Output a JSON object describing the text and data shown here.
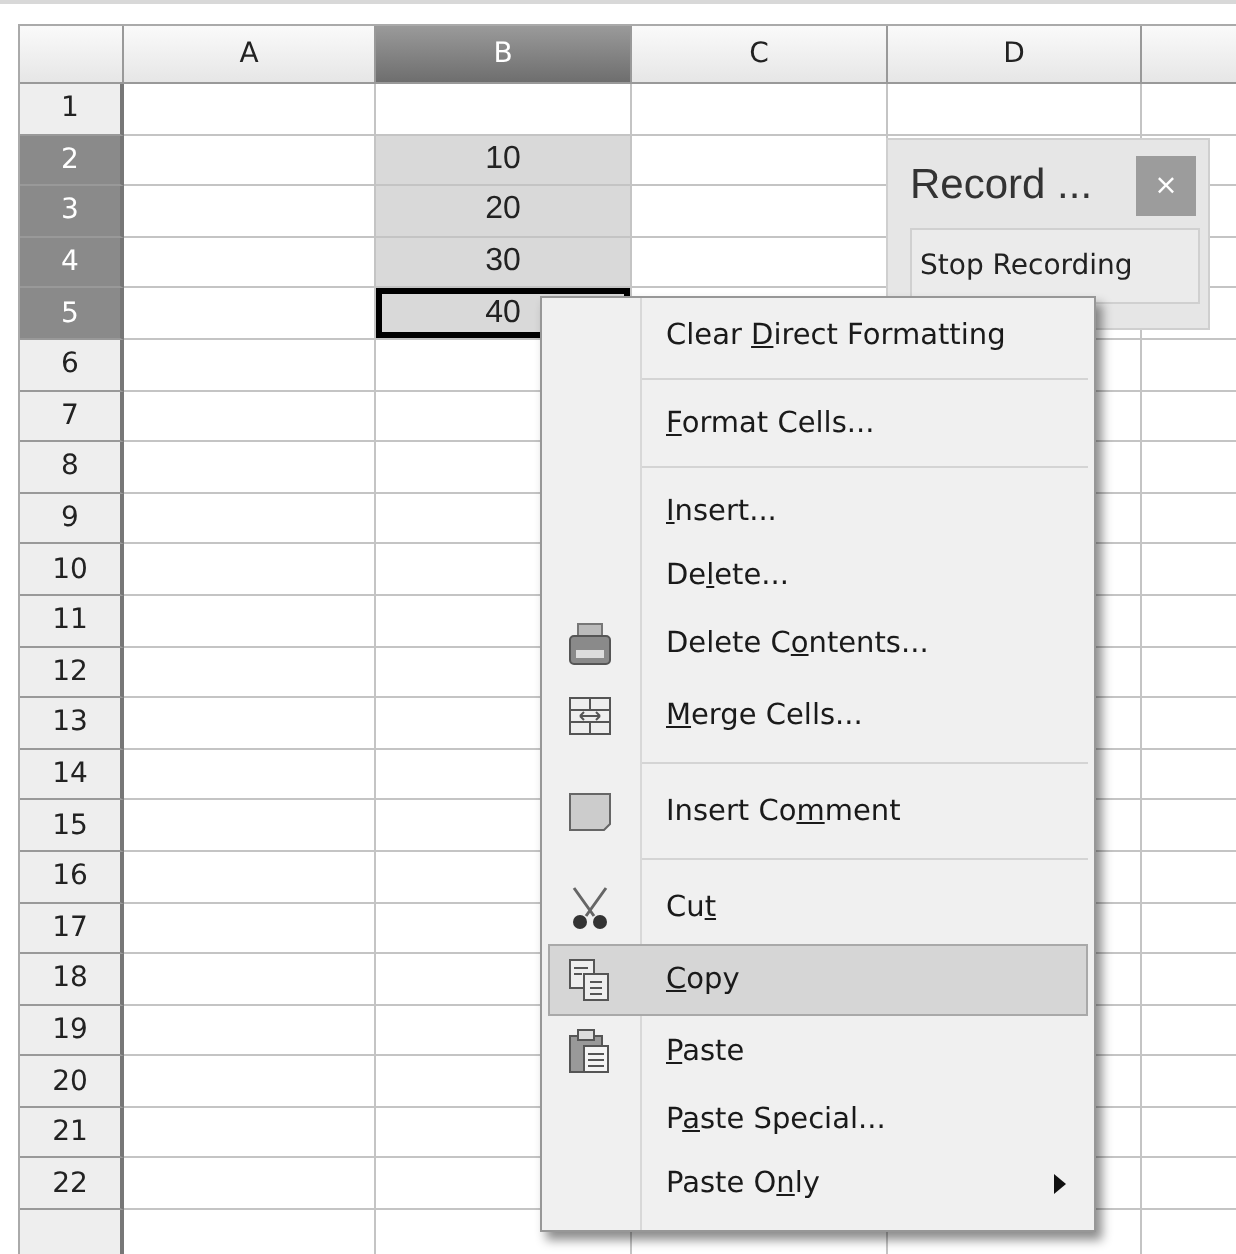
{
  "sheet": {
    "columns": [
      {
        "label": "A",
        "selected": false
      },
      {
        "label": "B",
        "selected": true
      },
      {
        "label": "C",
        "selected": false
      },
      {
        "label": "D",
        "selected": false
      }
    ],
    "rows": [
      {
        "label": "1",
        "selected": false
      },
      {
        "label": "2",
        "selected": true,
        "cells": [
          null,
          {
            "value": "10",
            "selected": true,
            "cursor": false
          },
          null,
          null
        ]
      },
      {
        "label": "3",
        "selected": true,
        "cells": [
          null,
          {
            "value": "20",
            "selected": true,
            "cursor": false
          },
          null,
          null
        ]
      },
      {
        "label": "4",
        "selected": true,
        "cells": [
          null,
          {
            "value": "30",
            "selected": true,
            "cursor": false
          },
          null,
          null
        ]
      },
      {
        "label": "5",
        "selected": true,
        "cells": [
          null,
          {
            "value": "40",
            "selected": true,
            "cursor": true
          },
          null,
          null
        ]
      },
      {
        "label": "6",
        "selected": false
      },
      {
        "label": "7",
        "selected": false
      },
      {
        "label": "8",
        "selected": false
      },
      {
        "label": "9",
        "selected": false
      },
      {
        "label": "10",
        "selected": false
      },
      {
        "label": "11",
        "selected": false
      },
      {
        "label": "12",
        "selected": false
      },
      {
        "label": "13",
        "selected": false
      },
      {
        "label": "14",
        "selected": false
      },
      {
        "label": "15",
        "selected": false
      },
      {
        "label": "16",
        "selected": false
      },
      {
        "label": "17",
        "selected": false
      },
      {
        "label": "18",
        "selected": false
      },
      {
        "label": "19",
        "selected": false
      },
      {
        "label": "20",
        "selected": false
      },
      {
        "label": "21",
        "selected": false
      },
      {
        "label": "22",
        "selected": false
      }
    ]
  },
  "record_toolbar": {
    "title": "Record ...",
    "close_label": "×",
    "button": "Stop Recording"
  },
  "context_menu": [
    {
      "kind": "item",
      "label": {
        "before": "Clear ",
        "key": "D",
        "after": "irect Formatting"
      },
      "selected": false,
      "submenu": false
    },
    {
      "kind": "separator"
    },
    {
      "kind": "item",
      "label": {
        "key": "F",
        "after": "ormat Cells..."
      },
      "selected": false,
      "submenu": false
    },
    {
      "kind": "separator"
    },
    {
      "kind": "item",
      "label": {
        "key": "I",
        "after": "nsert..."
      },
      "selected": false,
      "submenu": false
    },
    {
      "kind": "item",
      "label": {
        "before": "De",
        "key": "l",
        "after": "ete..."
      },
      "selected": false,
      "submenu": false
    },
    {
      "kind": "item",
      "label": {
        "before": "Delete C",
        "key": "o",
        "after": "ntents..."
      },
      "selected": false,
      "submenu": false
    },
    {
      "kind": "item",
      "label": {
        "key": "M",
        "after": "erge Cells..."
      },
      "selected": false,
      "submenu": false
    },
    {
      "kind": "separator"
    },
    {
      "kind": "item",
      "label": {
        "before": "Insert Co",
        "key": "m",
        "after": "ment"
      },
      "selected": false,
      "submenu": false
    },
    {
      "kind": "separator"
    },
    {
      "kind": "item",
      "label": {
        "before": "Cu",
        "key": "t"
      },
      "selected": false,
      "submenu": false
    },
    {
      "kind": "item",
      "label": {
        "key": "C",
        "after": "opy"
      },
      "selected": true,
      "submenu": false
    },
    {
      "kind": "item",
      "label": {
        "key": "P",
        "after": "aste"
      },
      "selected": false,
      "submenu": false
    },
    {
      "kind": "item",
      "label": {
        "before": "P",
        "key": "a",
        "after": "ste Special..."
      },
      "selected": false,
      "submenu": false
    },
    {
      "kind": "item",
      "label": {
        "before": "Paste O",
        "key": "n",
        "after": "ly"
      },
      "selected": false,
      "submenu": true
    }
  ]
}
